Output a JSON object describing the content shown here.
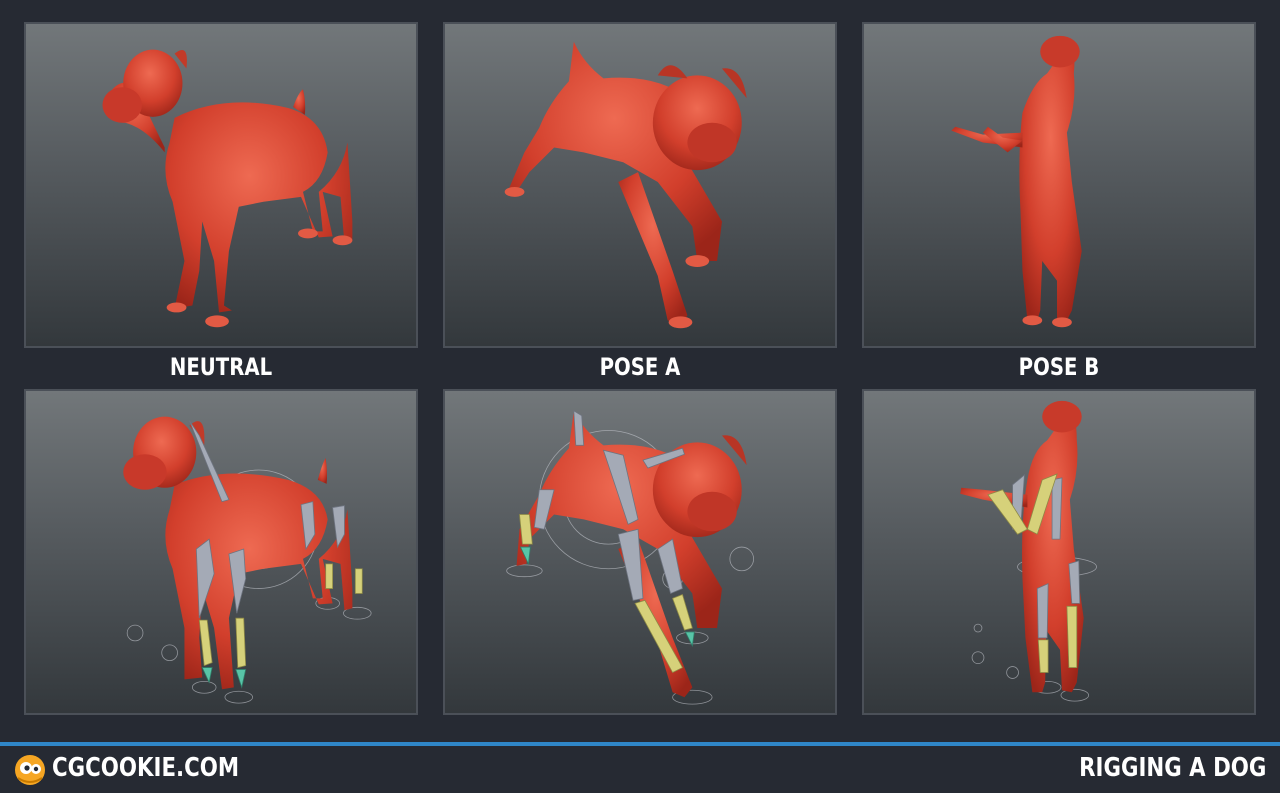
{
  "poses": [
    {
      "label": "NEUTRAL"
    },
    {
      "label": "POSE A"
    },
    {
      "label": "POSE B"
    }
  ],
  "footer": {
    "site": "CGCOOKIE.COM",
    "course": "RIGGING A DOG"
  },
  "colors": {
    "background": "#262a33",
    "accent_line": "#2f86c8",
    "dog_body": "#d9442f",
    "bone": "#a4aab6",
    "ik_bone": "#d6d17a",
    "foot_bone": "#58c4a7",
    "logo": "#f6a623"
  },
  "icons": [
    "cgcookie-logo-icon"
  ]
}
